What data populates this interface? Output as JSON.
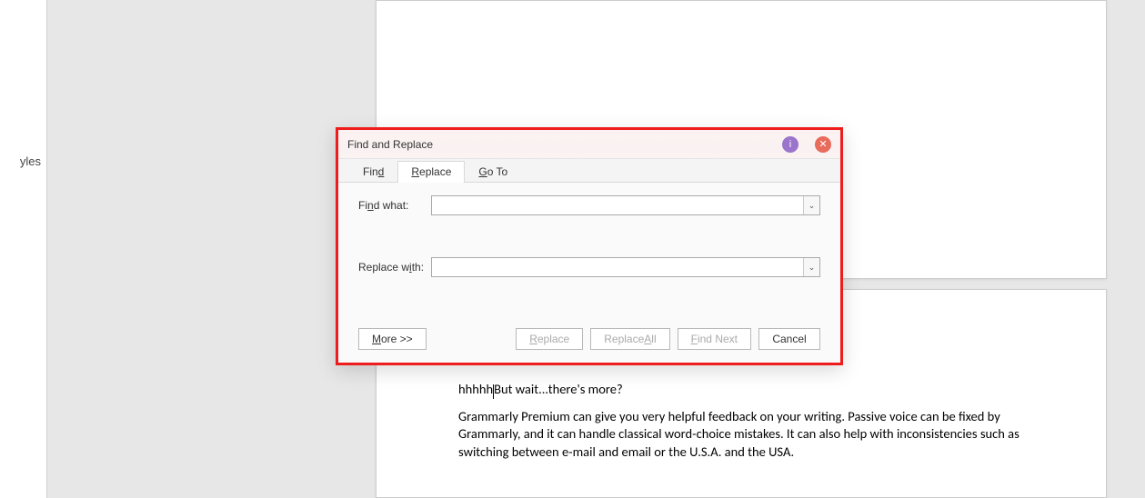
{
  "sidebar": {
    "partial_label": "yles"
  },
  "document": {
    "line1a": "hhhhh",
    "line1b": "But wait...there's more?",
    "para2": "Grammarly Premium can give you very helpful feedback on your writing. Passive voice can be fixed by Grammarly, and it can handle classical word-choice mistakes. It can also help with inconsistencies such as switching between e-mail and email or the U.S.A. and the USA."
  },
  "dialog": {
    "title": "Find and Replace",
    "help_glyph": "i",
    "close_glyph": "✕",
    "tabs": {
      "find_prefix": "Fin",
      "find_ul": "d",
      "replace_ul": "R",
      "replace_suffix": "eplace",
      "goto_prefix": "",
      "goto_ul": "G",
      "goto_suffix": "o To"
    },
    "find_label_prefix": "Fi",
    "find_label_ul": "n",
    "find_label_suffix": "d what:",
    "replace_label_prefix": "Replace w",
    "replace_label_ul": "i",
    "replace_label_suffix": "th:",
    "find_value": "",
    "replace_value": "",
    "dropdown_glyph": "⌄",
    "buttons": {
      "more_ul": "M",
      "more_suffix": "ore >>",
      "replace_ul": "R",
      "replace_suffix": "eplace",
      "replace_all_prefix": "Replace ",
      "replace_all_ul": "A",
      "replace_all_suffix": "ll",
      "find_next_ul": "F",
      "find_next_suffix": "ind Next",
      "cancel": "Cancel"
    }
  }
}
